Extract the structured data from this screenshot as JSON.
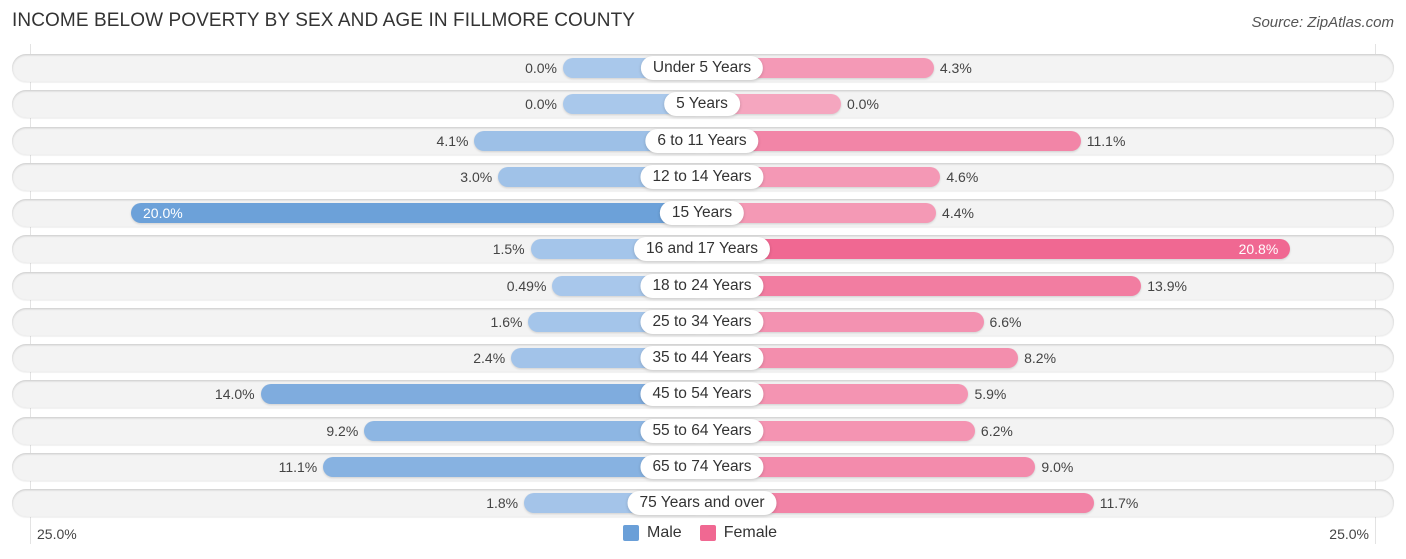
{
  "header": {
    "title": "INCOME BELOW POVERTY BY SEX AND AGE IN FILLMORE COUNTY",
    "source": "Source: ZipAtlas.com"
  },
  "colors": {
    "male_light": "#a9c8eb",
    "male_strong": "#6a9fd8",
    "female_light": "#f5a6bf",
    "female_strong": "#f06892",
    "row_bg": "#f3f3f3"
  },
  "chart_data": {
    "type": "bar",
    "orientation": "horizontal-diverging",
    "title": "INCOME BELOW POVERTY BY SEX AND AGE IN FILLMORE COUNTY",
    "categories": [
      "Under 5 Years",
      "5 Years",
      "6 to 11 Years",
      "12 to 14 Years",
      "15 Years",
      "16 and 17 Years",
      "18 to 24 Years",
      "25 to 34 Years",
      "35 to 44 Years",
      "45 to 54 Years",
      "55 to 64 Years",
      "65 to 74 Years",
      "75 Years and over"
    ],
    "series": [
      {
        "name": "Male",
        "values": [
          0.0,
          0.0,
          4.1,
          3.0,
          20.0,
          1.5,
          0.49,
          1.6,
          2.4,
          14.0,
          9.2,
          11.1,
          1.8
        ],
        "labels": [
          "0.0%",
          "0.0%",
          "4.1%",
          "3.0%",
          "20.0%",
          "1.5%",
          "0.49%",
          "1.6%",
          "2.4%",
          "14.0%",
          "9.2%",
          "11.1%",
          "1.8%"
        ]
      },
      {
        "name": "Female",
        "values": [
          4.3,
          0.0,
          11.1,
          4.6,
          4.4,
          20.8,
          13.9,
          6.6,
          8.2,
          5.9,
          6.2,
          9.0,
          11.7
        ],
        "labels": [
          "4.3%",
          "0.0%",
          "11.1%",
          "4.6%",
          "4.4%",
          "20.8%",
          "13.9%",
          "6.6%",
          "8.2%",
          "5.9%",
          "6.2%",
          "9.0%",
          "11.7%"
        ]
      }
    ],
    "xlim": [
      -25,
      25
    ],
    "axis_labels": {
      "left": "25.0%",
      "right": "25.0%"
    },
    "legend": {
      "position": "bottom-center",
      "entries": [
        "Male",
        "Female"
      ]
    },
    "unit": "%"
  }
}
